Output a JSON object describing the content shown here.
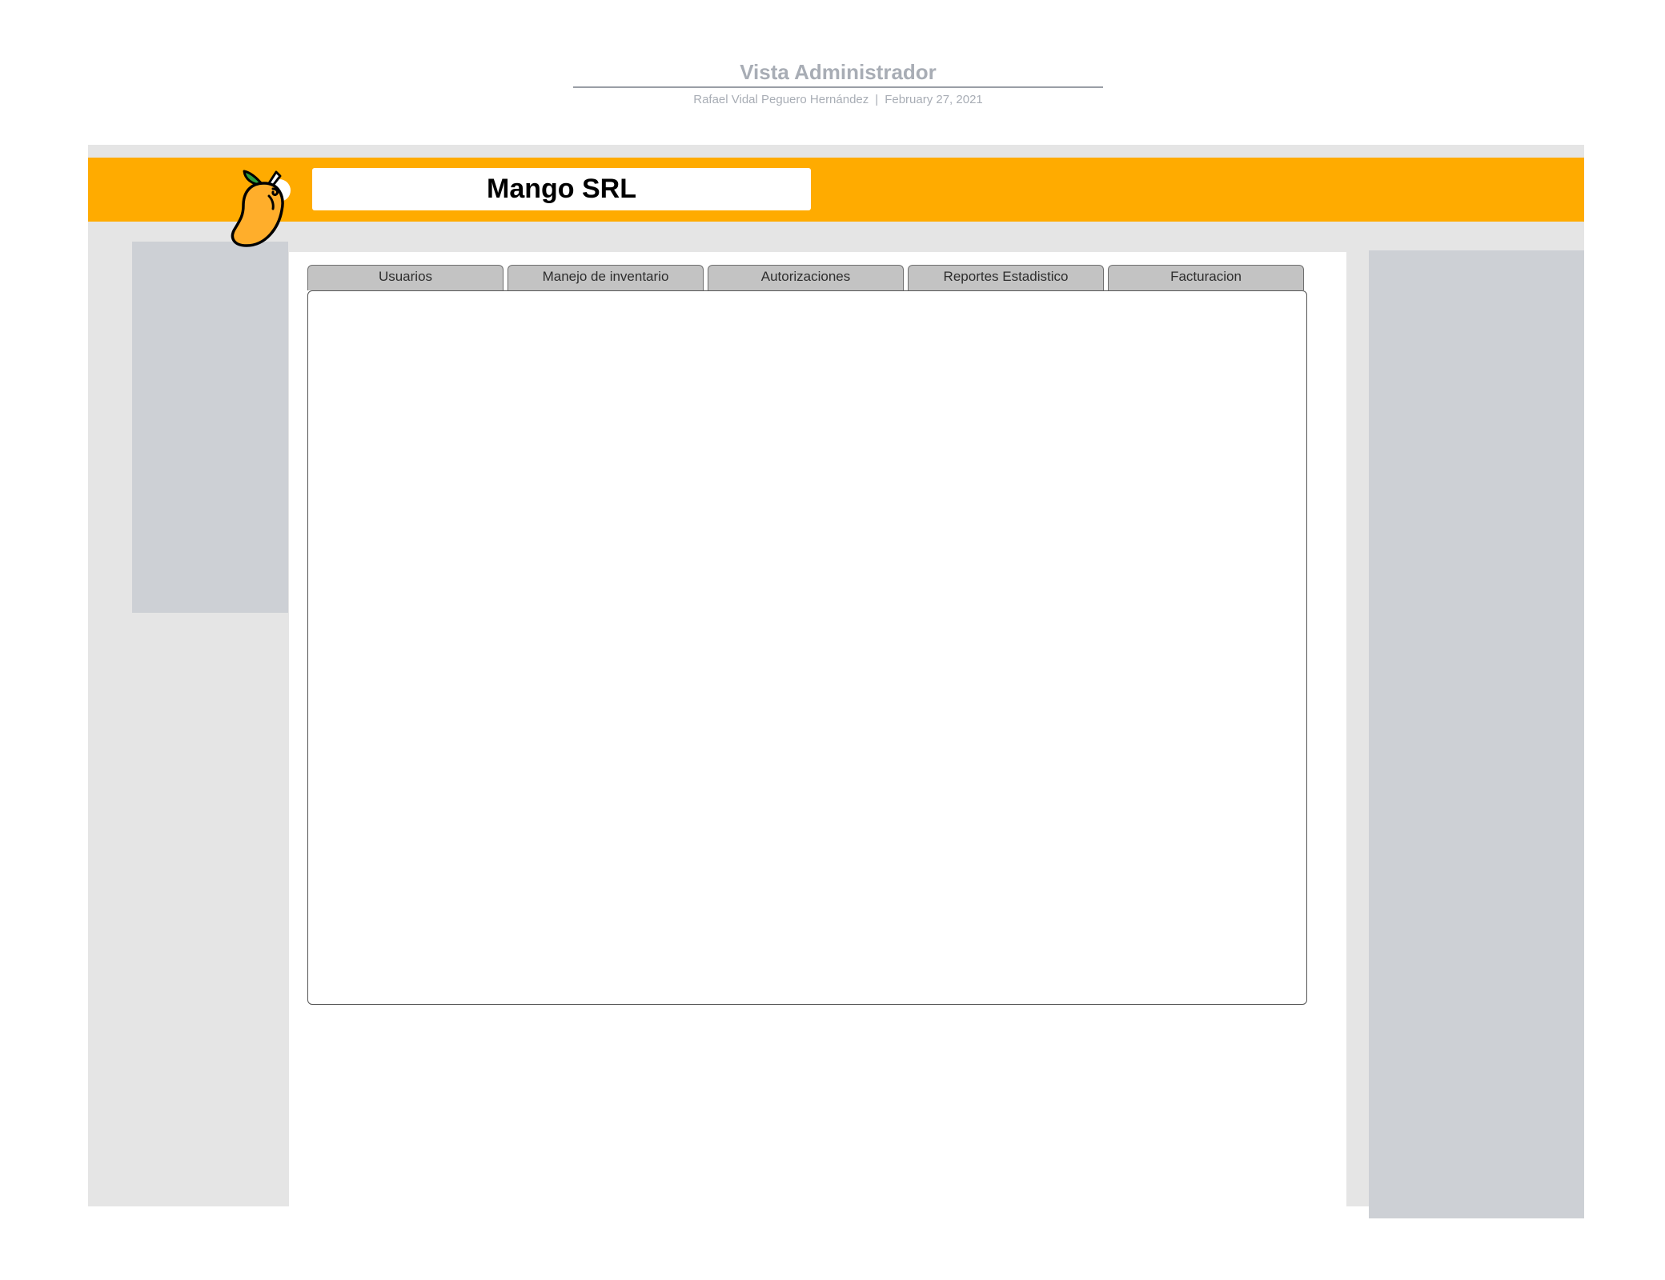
{
  "document": {
    "title": "Vista Administrador",
    "author": "Rafael Vidal Peguero Hernández",
    "separator": "|",
    "date": "February 27, 2021"
  },
  "header": {
    "brand_name": "Mango SRL",
    "logo_icon": "mango-icon",
    "bar_color": "#ffab00"
  },
  "tabs": [
    {
      "label": "Usuarios"
    },
    {
      "label": "Manejo de inventario"
    },
    {
      "label": "Autorizaciones"
    },
    {
      "label": "Reportes Estadistico"
    },
    {
      "label": "Facturacion"
    }
  ],
  "colors": {
    "accent": "#ffab00",
    "frame": "#e5e5e5",
    "side_panel": "#cdd0d5",
    "tab": "#c3c3c3",
    "mango": "#ffae2b",
    "leaf": "#2e9e3a"
  }
}
